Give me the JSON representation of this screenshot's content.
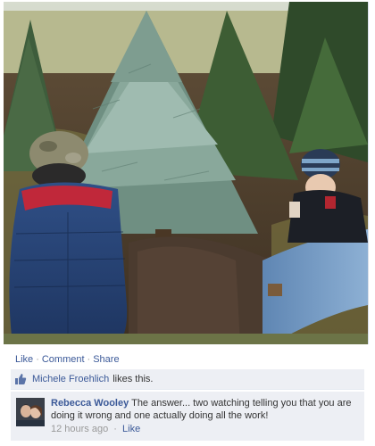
{
  "actions": {
    "like_label": "Like",
    "comment_label": "Comment",
    "share_label": "Share",
    "separator": "·"
  },
  "likes": {
    "liker_name": "Michele Froehlich",
    "likes_text": "likes this."
  },
  "comment": {
    "author": "Rebecca Wooley",
    "text": "The answer... two watching telling you that you are doing it wrong and one actually doing all the work!",
    "timestamp": "12 hours ago",
    "separator": "·",
    "like_label": "Like"
  },
  "colors": {
    "link": "#3b5998",
    "feedback_bg": "#edeff4",
    "meta_grey": "#999999"
  }
}
